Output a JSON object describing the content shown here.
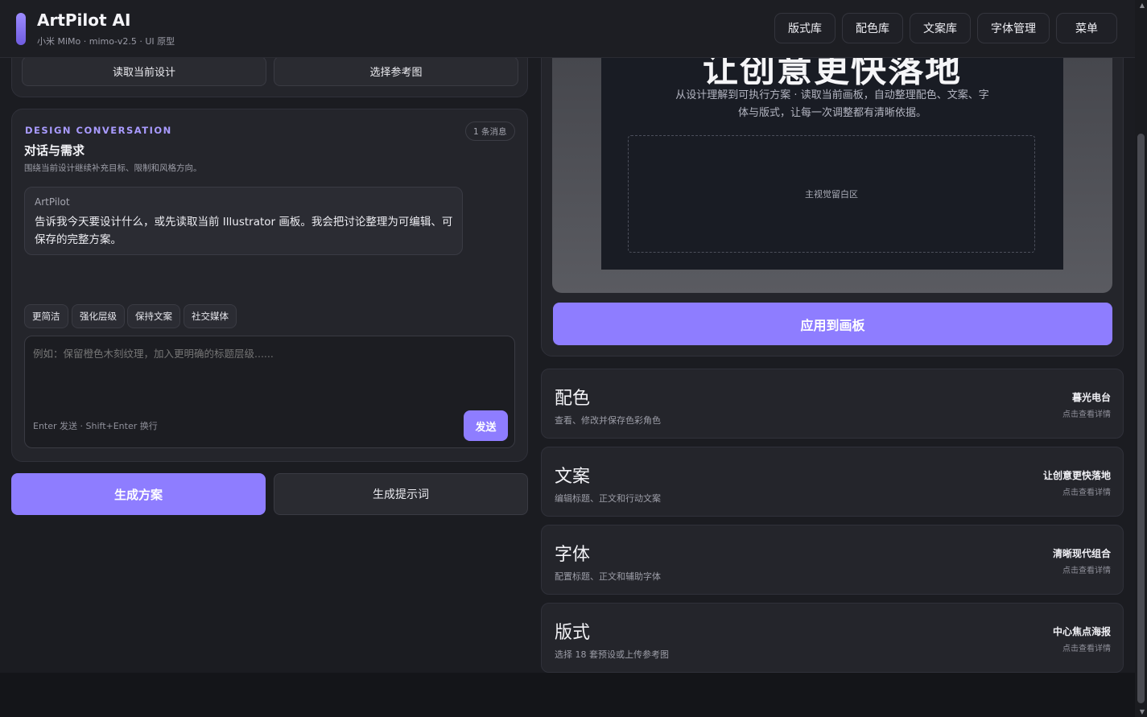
{
  "header": {
    "title": "ArtPilot AI",
    "subtitle": "小米 MiMo · mimo-v2.5 · UI 原型",
    "nav": [
      "版式库",
      "配色库",
      "文案库",
      "字体管理",
      "菜单"
    ]
  },
  "top_actions": {
    "read_design": "读取当前设计",
    "select_reference": "选择参考图"
  },
  "conversation": {
    "eyebrow": "DESIGN CONVERSATION",
    "title": "对话与需求",
    "description": "围绕当前设计继续补充目标、限制和风格方向。",
    "message_count": "1 条消息",
    "messages": [
      {
        "sender": "ArtPilot",
        "text": "告诉我今天要设计什么，或先读取当前 Illustrator 画板。我会把讨论整理为可编辑、可保存的完整方案。"
      }
    ],
    "chips": [
      "更简洁",
      "强化层级",
      "保持文案",
      "社交媒体"
    ],
    "input_placeholder": "例如：保留橙色木刻纹理，加入更明确的标题层级......",
    "input_hint": "Enter 发送 · Shift+Enter 换行",
    "send_label": "发送"
  },
  "bottom_actions": {
    "generate_plan": "生成方案",
    "generate_prompt": "生成提示词"
  },
  "preview": {
    "poster_title": "让创意更快落地",
    "poster_description": "从设计理解到可执行方案 · 读取当前画板，自动整理配色、文案、字体与版式，让每一次调整都有清晰依据。",
    "visual_placeholder": "主视觉留白区",
    "apply_label": "应用到画板"
  },
  "sections": [
    {
      "title": "配色",
      "description": "查看、修改并保存色彩角色",
      "value": "暮光电台",
      "hint": "点击查看详情"
    },
    {
      "title": "文案",
      "description": "编辑标题、正文和行动文案",
      "value": "让创意更快落地",
      "hint": "点击查看详情"
    },
    {
      "title": "字体",
      "description": "配置标题、正文和辅助字体",
      "value": "清晰现代组合",
      "hint": "点击查看详情"
    },
    {
      "title": "版式",
      "description": "选择 18 套预设或上传参考图",
      "value": "中心焦点海报",
      "hint": "点击查看详情"
    }
  ],
  "colors": {
    "accent": "#8e7dff",
    "background": "#1b1c21",
    "card": "#24252b"
  }
}
